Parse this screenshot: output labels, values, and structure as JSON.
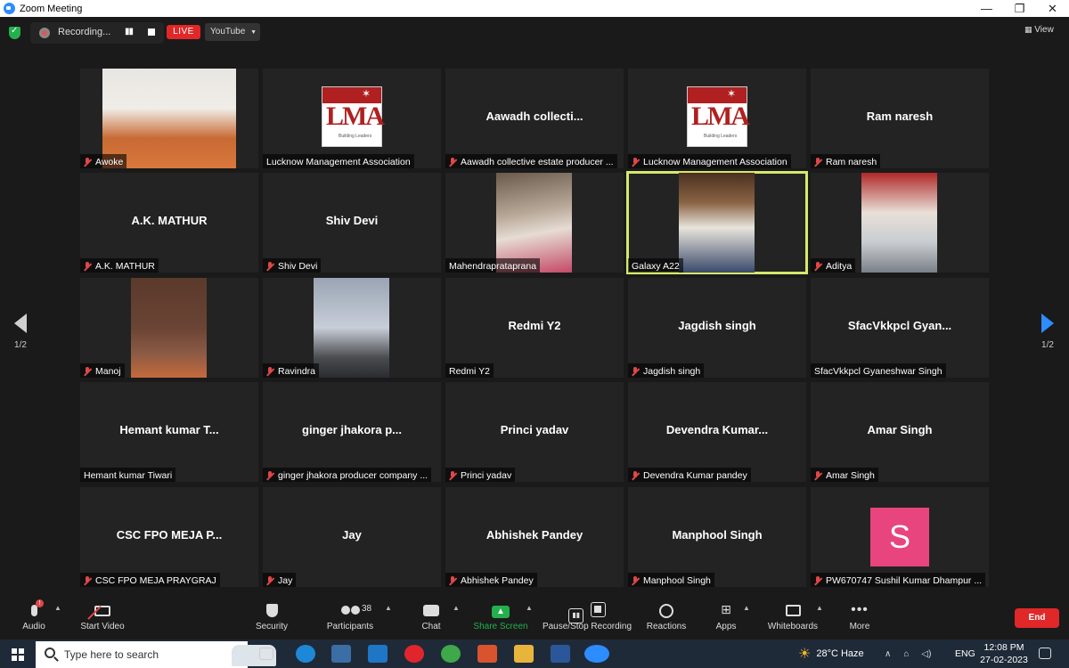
{
  "window": {
    "title": "Zoom Meeting",
    "minimize": "—",
    "restore": "❐",
    "close": "✕"
  },
  "meeting_bar": {
    "recording_label": "Recording...",
    "pause_glyph": "▮▮",
    "live_label": "LIVE",
    "stream_target": "YouTube",
    "view_label": "View"
  },
  "pager": {
    "left_label": "1/2",
    "right_label": "1/2"
  },
  "tiles": [
    {
      "name": "Awoke",
      "big": "",
      "muted": true
    },
    {
      "name": "Lucknow Management Association",
      "big": "",
      "muted": false,
      "logo": "LMA"
    },
    {
      "name": "Aawadh collective estate producer ...",
      "big": "Aawadh  collecti...",
      "muted": true
    },
    {
      "name": "Lucknow Management Association",
      "big": "",
      "muted": true,
      "logo": "LMA"
    },
    {
      "name": "Ram naresh",
      "big": "Ram naresh",
      "muted": true
    },
    {
      "name": "A.K. MATHUR",
      "big": "A.K. MATHUR",
      "muted": true
    },
    {
      "name": "Shiv Devi",
      "big": "Shiv Devi",
      "muted": true
    },
    {
      "name": "Mahendraprataprana",
      "big": "",
      "muted": false
    },
    {
      "name": "Galaxy A22",
      "big": "",
      "muted": false
    },
    {
      "name": "Aditya",
      "big": "",
      "muted": true
    },
    {
      "name": "Manoj",
      "big": "",
      "muted": true
    },
    {
      "name": "Ravindra",
      "big": "",
      "muted": true
    },
    {
      "name": "Redmi Y2",
      "big": "Redmi Y2",
      "muted": false
    },
    {
      "name": "Jagdish singh",
      "big": "Jagdish singh",
      "muted": true
    },
    {
      "name": "SfacVkkpcl Gyaneshwar Singh",
      "big": "SfacVkkpcl  Gyan...",
      "muted": false
    },
    {
      "name": "Hemant kumar Tiwari",
      "big": "Hemant  kumar  T...",
      "muted": false
    },
    {
      "name": "ginger jhakora producer company ...",
      "big": "ginger  jhakora  p...",
      "muted": true
    },
    {
      "name": "Princi yadav",
      "big": "Princi yadav",
      "muted": true
    },
    {
      "name": "Devendra Kumar pandey",
      "big": "Devendra  Kumar...",
      "muted": true
    },
    {
      "name": "Amar Singh",
      "big": "Amar Singh",
      "muted": true
    },
    {
      "name": "CSC FPO MEJA PRAYGRAJ",
      "big": "CSC FPO MEJA P...",
      "muted": true
    },
    {
      "name": "Jay",
      "big": "Jay",
      "muted": true
    },
    {
      "name": "Abhishek Pandey",
      "big": "Abhishek Pandey",
      "muted": true
    },
    {
      "name": "Manphool Singh",
      "big": "Manphool Singh",
      "muted": true
    },
    {
      "name": "PW670747 Sushil Kumar Dhampur ...",
      "big": "",
      "muted": true,
      "avatar": "S"
    }
  ],
  "logo_text": "LMA",
  "logo_tag": "Building Leaders",
  "toolbar": {
    "audio": "Audio",
    "audio_badge": "!",
    "video": "Start Video",
    "security": "Security",
    "participants": "Participants",
    "participants_count": "38",
    "chat": "Chat",
    "share": "Share Screen",
    "record": "Pause/Stop Recording",
    "reactions": "Reactions",
    "apps": "Apps",
    "whiteboards": "Whiteboards",
    "more": "More",
    "end": "End"
  },
  "taskbar": {
    "search_placeholder": "Type here to search",
    "weather": "28°C  Haze",
    "lang": "ENG",
    "time": "12:08 PM",
    "date": "27-02-2023"
  },
  "colors": {
    "accent": "#2d8cff",
    "live": "#e02828",
    "active_speaker": "#d6e86b",
    "share": "#23b04d"
  }
}
